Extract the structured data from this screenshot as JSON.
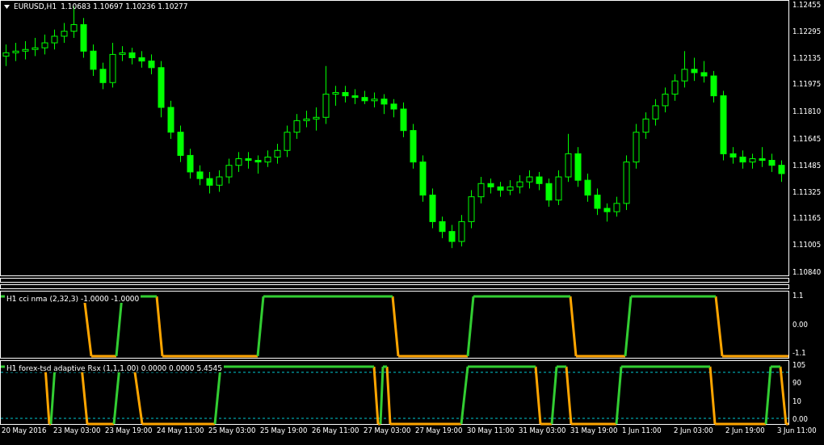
{
  "chart_header": {
    "symbol": "EURUSD,H1",
    "ohlc": "1.10683 1.10697 1.10236 1.10277"
  },
  "price_chart": {
    "chart_data": {
      "type": "candlestick",
      "ylim": [
        1.10825,
        1.12484
      ],
      "yticks": [
        {
          "value": 1.12455,
          "label": "1.12455"
        },
        {
          "value": 1.12295,
          "label": "1.12295"
        },
        {
          "value": 1.12135,
          "label": "1.12135"
        },
        {
          "value": 1.11975,
          "label": "1.11975"
        },
        {
          "value": 1.1181,
          "label": "1.11810"
        },
        {
          "value": 1.11645,
          "label": "1.11645"
        },
        {
          "value": 1.11485,
          "label": "1.11485"
        },
        {
          "value": 1.11325,
          "label": "1.11325"
        },
        {
          "value": 1.11165,
          "label": "1.11165"
        },
        {
          "value": 1.11005,
          "label": "1.11005"
        },
        {
          "value": 1.1084,
          "label": "1.10840"
        }
      ],
      "ohlc": [
        [
          1.1215,
          1.1222,
          1.1209,
          1.1217
        ],
        [
          1.1217,
          1.1223,
          1.1212,
          1.1218
        ],
        [
          1.1218,
          1.1224,
          1.1213,
          1.1219
        ],
        [
          1.1219,
          1.1226,
          1.1215,
          1.122
        ],
        [
          1.122,
          1.1228,
          1.1216,
          1.1223
        ],
        [
          1.1223,
          1.1231,
          1.1219,
          1.1227
        ],
        [
          1.1227,
          1.1235,
          1.1223,
          1.123
        ],
        [
          1.123,
          1.1245,
          1.1226,
          1.1234
        ],
        [
          1.1234,
          1.1238,
          1.1214,
          1.1218
        ],
        [
          1.1218,
          1.1222,
          1.1203,
          1.1207
        ],
        [
          1.1207,
          1.1211,
          1.1195,
          1.1199
        ],
        [
          1.1199,
          1.1223,
          1.1196,
          1.1216
        ],
        [
          1.1216,
          1.1221,
          1.1212,
          1.1217
        ],
        [
          1.1217,
          1.122,
          1.121,
          1.1214
        ],
        [
          1.1214,
          1.1218,
          1.1208,
          1.1212
        ],
        [
          1.1212,
          1.1216,
          1.1204,
          1.1208
        ],
        [
          1.1208,
          1.1212,
          1.1178,
          1.1184
        ],
        [
          1.1184,
          1.1188,
          1.1165,
          1.1169
        ],
        [
          1.1169,
          1.1173,
          1.1151,
          1.1155
        ],
        [
          1.1155,
          1.1159,
          1.1141,
          1.1145
        ],
        [
          1.1145,
          1.1149,
          1.1137,
          1.1141
        ],
        [
          1.1141,
          1.1145,
          1.1132,
          1.1137
        ],
        [
          1.1137,
          1.1146,
          1.1133,
          1.1142
        ],
        [
          1.1142,
          1.1153,
          1.1138,
          1.1149
        ],
        [
          1.1149,
          1.1157,
          1.1145,
          1.1153
        ],
        [
          1.1153,
          1.1157,
          1.1147,
          1.1152
        ],
        [
          1.1152,
          1.1155,
          1.1144,
          1.1151
        ],
        [
          1.1151,
          1.1158,
          1.1148,
          1.1154
        ],
        [
          1.1154,
          1.1162,
          1.115,
          1.1158
        ],
        [
          1.1158,
          1.1173,
          1.1154,
          1.1169
        ],
        [
          1.1169,
          1.118,
          1.1165,
          1.1176
        ],
        [
          1.1176,
          1.1182,
          1.1172,
          1.1177
        ],
        [
          1.1177,
          1.1184,
          1.117,
          1.1178
        ],
        [
          1.1178,
          1.1209,
          1.1174,
          1.1192
        ],
        [
          1.1192,
          1.1197,
          1.1185,
          1.1193
        ],
        [
          1.1193,
          1.1197,
          1.1187,
          1.1191
        ],
        [
          1.1191,
          1.1195,
          1.1186,
          1.119
        ],
        [
          1.119,
          1.1194,
          1.1186,
          1.1188
        ],
        [
          1.1188,
          1.1193,
          1.1184,
          1.1189
        ],
        [
          1.1189,
          1.1192,
          1.118,
          1.1186
        ],
        [
          1.1186,
          1.1189,
          1.1178,
          1.1183
        ],
        [
          1.1183,
          1.1187,
          1.1166,
          1.117
        ],
        [
          1.117,
          1.1174,
          1.1147,
          1.1151
        ],
        [
          1.1151,
          1.1155,
          1.1127,
          1.1131
        ],
        [
          1.1131,
          1.1135,
          1.1111,
          1.1115
        ],
        [
          1.1115,
          1.1118,
          1.1105,
          1.1109
        ],
        [
          1.1109,
          1.1113,
          1.1099,
          1.1103
        ],
        [
          1.1103,
          1.1119,
          1.11,
          1.1115
        ],
        [
          1.1115,
          1.1134,
          1.1111,
          1.113
        ],
        [
          1.113,
          1.1142,
          1.1126,
          1.1138
        ],
        [
          1.1138,
          1.1141,
          1.1132,
          1.1136
        ],
        [
          1.1136,
          1.1139,
          1.113,
          1.1134
        ],
        [
          1.1134,
          1.114,
          1.1131,
          1.1136
        ],
        [
          1.1136,
          1.1143,
          1.1132,
          1.1139
        ],
        [
          1.1139,
          1.1146,
          1.1135,
          1.1142
        ],
        [
          1.1142,
          1.1145,
          1.1134,
          1.1138
        ],
        [
          1.1138,
          1.1141,
          1.1124,
          1.1128
        ],
        [
          1.1128,
          1.1146,
          1.1125,
          1.1142
        ],
        [
          1.1142,
          1.1168,
          1.1139,
          1.1156
        ],
        [
          1.1156,
          1.116,
          1.1136,
          1.114
        ],
        [
          1.114,
          1.1144,
          1.1127,
          1.1131
        ],
        [
          1.1131,
          1.1135,
          1.1119,
          1.1123
        ],
        [
          1.1123,
          1.1126,
          1.1115,
          1.1121
        ],
        [
          1.1121,
          1.113,
          1.1118,
          1.1126
        ],
        [
          1.1126,
          1.1155,
          1.1122,
          1.1151
        ],
        [
          1.1151,
          1.1174,
          1.1147,
          1.1169
        ],
        [
          1.1169,
          1.1181,
          1.1165,
          1.1177
        ],
        [
          1.1177,
          1.1189,
          1.1173,
          1.1185
        ],
        [
          1.1185,
          1.1196,
          1.1181,
          1.1192
        ],
        [
          1.1192,
          1.1204,
          1.1188,
          1.12
        ],
        [
          1.12,
          1.1218,
          1.1196,
          1.1207
        ],
        [
          1.1207,
          1.1214,
          1.12,
          1.1205
        ],
        [
          1.1205,
          1.1212,
          1.1199,
          1.1203
        ],
        [
          1.1203,
          1.1206,
          1.1187,
          1.1191
        ],
        [
          1.1191,
          1.1194,
          1.1152,
          1.1156
        ],
        [
          1.1156,
          1.116,
          1.115,
          1.1154
        ],
        [
          1.1154,
          1.1158,
          1.1147,
          1.1151
        ],
        [
          1.1151,
          1.1156,
          1.1147,
          1.1153
        ],
        [
          1.1153,
          1.116,
          1.1148,
          1.1152
        ],
        [
          1.1152,
          1.1156,
          1.1145,
          1.1149
        ],
        [
          1.1149,
          1.1152,
          1.1139,
          1.1144
        ]
      ]
    }
  },
  "indicators": [
    {
      "kind": "cci",
      "label": "H1 cci nma (2,32,3) -1.0000 -1.0000",
      "scale": [
        "1.1",
        "0.00",
        "-1.1"
      ]
    },
    {
      "kind": "rsx",
      "label": "H1 forex-tsd adaptive Rsx (1,1,1.00) 0.0000 0.0000 5.4545",
      "scale": [
        "105",
        "90",
        "10",
        "0.00"
      ]
    }
  ],
  "time_axis": [
    "20 May 2016",
    "23 May 03:00",
    "23 May 19:00",
    "24 May 11:00",
    "25 May 03:00",
    "25 May 19:00",
    "26 May 11:00",
    "27 May 03:00",
    "27 May 19:00",
    "30 May 11:00",
    "31 May 03:00",
    "31 May 19:00",
    "1 Jun 11:00",
    "2 Jun 03:00",
    "2 Jun 19:00",
    "3 Jun 11:00"
  ]
}
